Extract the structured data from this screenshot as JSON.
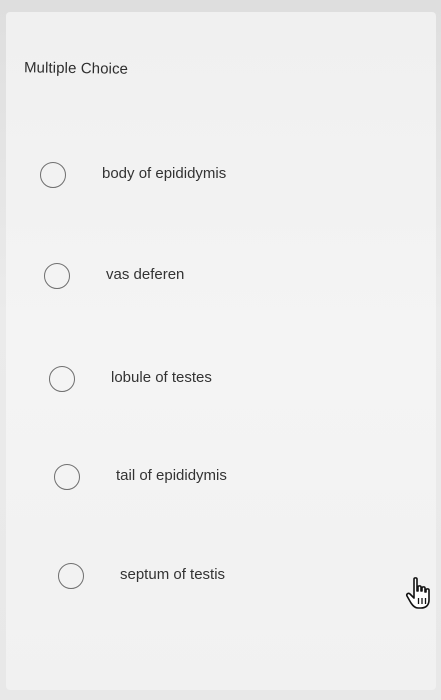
{
  "question": {
    "type_label": "Multiple Choice"
  },
  "options": [
    {
      "label": "body of epididymis",
      "selected": false
    },
    {
      "label": "vas deferen",
      "selected": false
    },
    {
      "label": "lobule of testes",
      "selected": false
    },
    {
      "label": "tail of epididymis",
      "selected": false
    },
    {
      "label": "septum of testis",
      "selected": false
    }
  ],
  "cursor": {
    "icon": "hand-pointer-icon"
  },
  "colors": {
    "background": "#e4e4e4",
    "panel": "#f2f2f2",
    "radio_border": "#6f6f6f",
    "text": "#333333"
  }
}
